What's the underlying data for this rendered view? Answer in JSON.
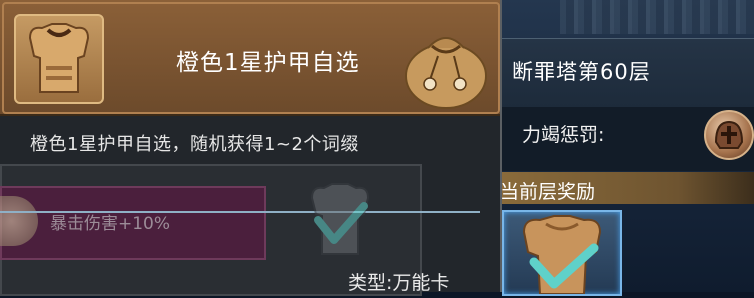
{
  "tooltip": {
    "item_title": "橙色1星护甲自选",
    "item_icon": "armor-icon",
    "bag_icon": "loot-bag-icon",
    "description": "橙色1星护甲自选，随机获得1~2个词缀",
    "affix": {
      "text": "暴击伤害+10%",
      "icon": "affix-emblem-icon"
    },
    "faded_icon": "armor-selected-icon",
    "type_label": "类型:万能卡"
  },
  "tower": {
    "title": "断罪塔第60层",
    "penalty_label": "力竭惩罚:",
    "penalty_icon": "helmet-icon",
    "reward_header": "当前层奖励",
    "reward_item_icon": "armor-reward-icon"
  },
  "colors": {
    "header_brown": "#8b6038",
    "panel_bg": "#22262b",
    "affix_purple": "#4b1f3d",
    "reward_gold": "#8a6b3b",
    "check_teal": "#5fd1c9"
  }
}
